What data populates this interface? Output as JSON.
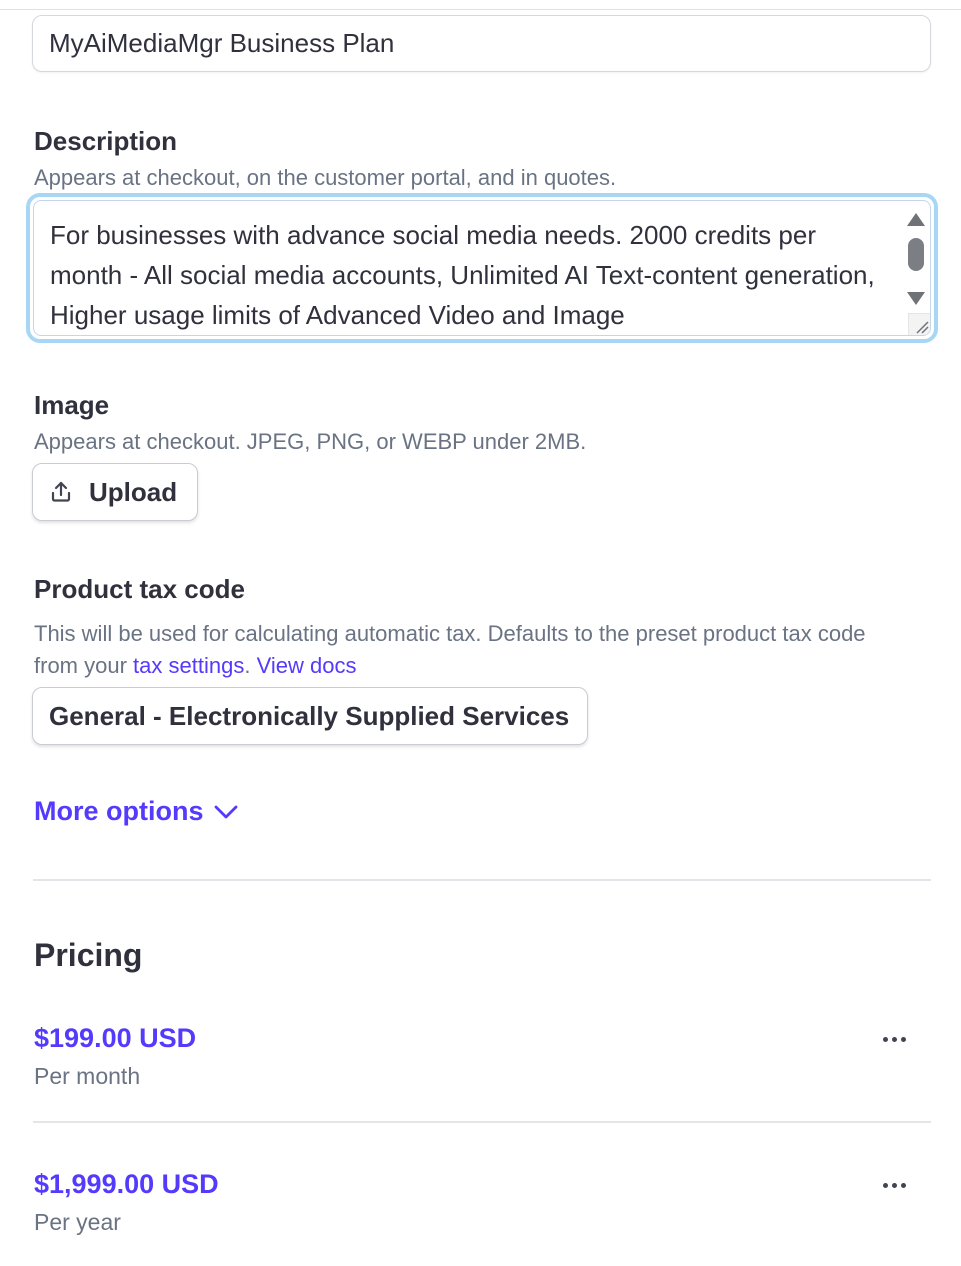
{
  "product_name": {
    "value": "MyAiMediaMgr Business Plan"
  },
  "description": {
    "label": "Description",
    "help": "Appears at checkout, on the customer portal, and in quotes.",
    "value": "For businesses with advance social media needs. 2000 credits per month - All social media accounts, Unlimited AI Text-content generation, Higher usage limits of Advanced Video and Image"
  },
  "image": {
    "label": "Image",
    "help": "Appears at checkout. JPEG, PNG, or WEBP under 2MB.",
    "upload_label": "Upload",
    "upload_icon": "upload-icon"
  },
  "tax_code": {
    "label": "Product tax code",
    "help_part1": "This will be used for calculating automatic tax. Defaults to the preset product tax code from your",
    "tax_settings_link": "tax settings",
    "help_part2": ".",
    "view_docs_link": "View docs",
    "selected_value": "General - Electronically Supplied Services"
  },
  "more_options": {
    "label": "More options",
    "icon": "chevron-down-icon"
  },
  "pricing": {
    "title": "Pricing",
    "prices": [
      {
        "amount": "$199.00 USD",
        "interval": "Per month"
      },
      {
        "amount": "$1,999.00 USD",
        "interval": "Per year"
      }
    ]
  },
  "colors": {
    "accent": "#533afd",
    "text": "#30313d",
    "muted": "#6a7383",
    "focus_ring": "#a8d7f5"
  }
}
